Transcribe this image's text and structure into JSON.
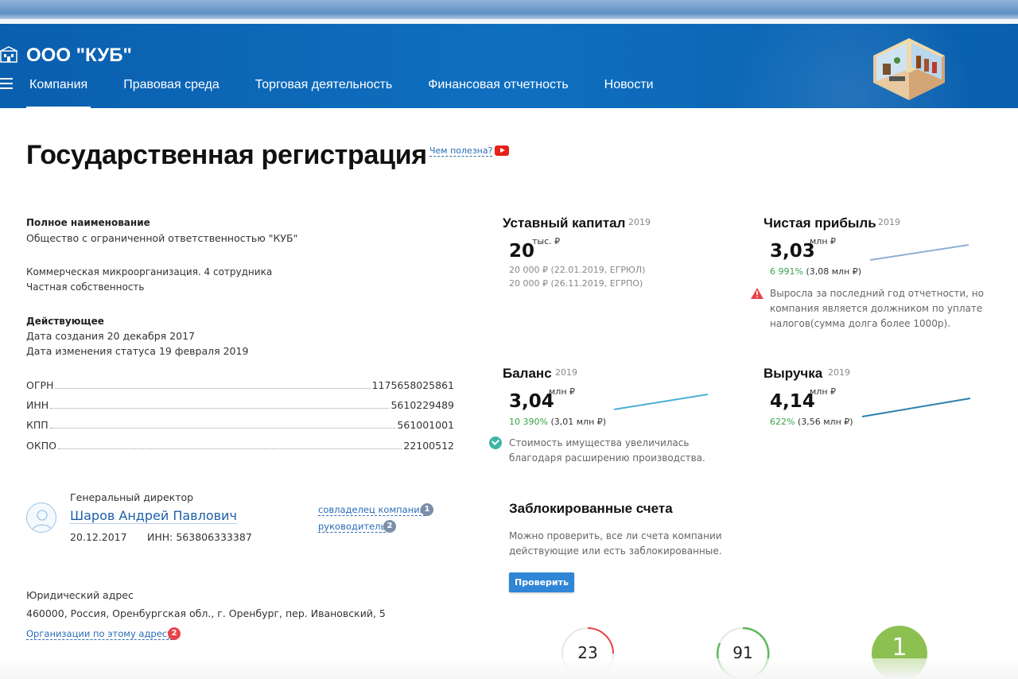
{
  "header": {
    "company_name": "ООО \"КУБ\"",
    "nav": [
      {
        "label": "Компания",
        "active": true
      },
      {
        "label": "Правовая среда"
      },
      {
        "label": "Торговая деятельность"
      },
      {
        "label": "Финансовая отчетность"
      },
      {
        "label": "Новости"
      }
    ]
  },
  "page": {
    "title": "Государственная регистрация",
    "useful_link": "Чем полезна?",
    "video_icon": "youtube-play-icon"
  },
  "company": {
    "full_name_label": "Полное наименование",
    "full_name": "Общество с ограниченной ответственностью \"КУБ\"",
    "category": "Коммерческая микроорганизация. 4 сотрудника",
    "ownership": "Частная собственность",
    "status": "Действующее",
    "created": "Дата создания 20 декабря 2017",
    "status_changed": "Дата изменения статуса 19 февраля 2019",
    "codes": [
      {
        "label": "ОГРН",
        "value": "1175658025861"
      },
      {
        "label": "ИНН",
        "value": "5610229489"
      },
      {
        "label": "КПП",
        "value": "561001001"
      },
      {
        "label": "ОКПО",
        "value": "22100512"
      }
    ]
  },
  "director": {
    "role": "Генеральный директор",
    "name": "Шаров Андрей Павлович",
    "date": "20.12.2017",
    "inn": "ИНН: 563806333387",
    "links": [
      {
        "label": "совладелец компаний",
        "count": "1"
      },
      {
        "label": "руководитель",
        "count": "2"
      }
    ]
  },
  "address": {
    "label": "Юридический адрес",
    "value": "460000, Россия, Оренбургская обл., г. Оренбург, пер. Ивановский, 5",
    "link": "Организации по этому адресу",
    "count": "2"
  },
  "metrics": {
    "capital": {
      "title": "Уставный капитал",
      "year": "2019",
      "value": "20",
      "unit": "тыс. ₽",
      "history": [
        "20 000 ₽ (22.01.2019, ЕГРЮЛ)",
        "20 000 ₽ (26.11.2019, ЕГРПО)"
      ]
    },
    "profit": {
      "title": "Чистая прибыль",
      "year": "2019",
      "value": "3,03",
      "unit": "млн ₽",
      "growth": "6 991%",
      "prev": "(3,08 млн ₽)",
      "note": [
        "Выросла за последний год отчетности, но",
        "компания является должником по уплате",
        "налогов(сумма долга более 1000р)."
      ],
      "trend_color": "#8fb0d4"
    },
    "balance": {
      "title": "Баланс",
      "year": "2019",
      "value": "3,04",
      "unit": "млн ₽",
      "growth": "10 390%",
      "prev": "(3,01 млн ₽)",
      "note": [
        "Стоимость имущества увеличилась",
        "благодаря расширению производства."
      ],
      "trend_color": "#4ab0d8"
    },
    "revenue": {
      "title": "Выручка",
      "year": "2019",
      "value": "4,14",
      "unit": "млн ₽",
      "growth": "622%",
      "prev": "(3,56 млн ₽)",
      "trend_color": "#2c7fae"
    }
  },
  "blocked": {
    "title": "Заблокированные счета",
    "text": [
      "Можно проверить, все ли счета компании",
      "действующие или есть заблокированные."
    ],
    "button": "Проверить"
  },
  "gauges": [
    {
      "value": "23",
      "color": "#e8434a"
    },
    {
      "value": "91",
      "color": "#5cb85c"
    },
    {
      "value": "1",
      "color": "#8cc152"
    }
  ],
  "colors": {
    "header_blue": "#0f6fbf",
    "link_blue": "#2a6db5",
    "success": "#3aa34a",
    "danger": "#e8434a"
  }
}
